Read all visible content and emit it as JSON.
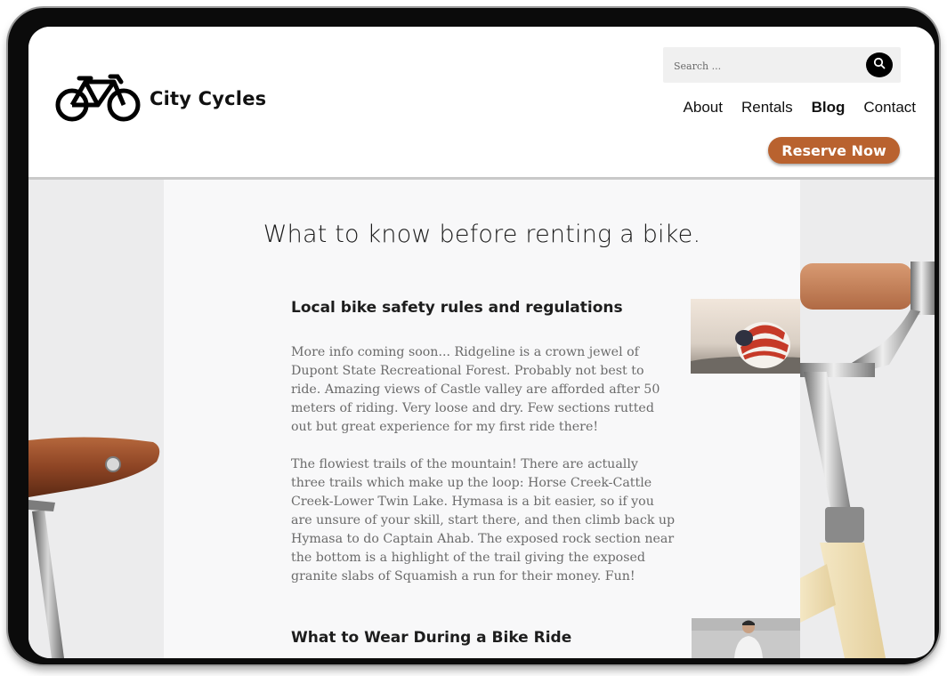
{
  "brand": {
    "name": "City Cycles"
  },
  "search": {
    "placeholder": "Search ..."
  },
  "nav": [
    {
      "label": "About",
      "active": false
    },
    {
      "label": "Rentals",
      "active": false
    },
    {
      "label": "Blog",
      "active": true
    },
    {
      "label": "Contact",
      "active": false
    }
  ],
  "cta": {
    "label": "Reserve Now",
    "color": "#b9622f"
  },
  "page": {
    "title": "What to know before renting a bike."
  },
  "sections": [
    {
      "title": "Local bike safety rules and regulations",
      "paragraphs": [
        "More info coming soon... Ridgeline is a crown jewel of Dupont State Recreational Forest. Probably not best to ride. Amazing views of Castle valley are afforded after 50 meters of riding. Very loose and dry. Few sections rutted out but great experience for my first ride there!",
        "The flowiest trails of the mountain! There are actually three trails which make up the loop: Horse Creek-Cattle Creek-Lower Twin Lake. Hymasa is a bit easier, so if you are unsure of your skill, start there, and then climb back up Hymasa to do Captain Ahab. The exposed rock section near the bottom is a highlight of the trail giving the exposed granite slabs of Squamish a run for their money. Fun!"
      ],
      "image": "helmet-photo"
    },
    {
      "title": "What to Wear During a Bike Ride",
      "image": "cyclist-photo"
    }
  ],
  "icons": {
    "logo": "bicycle-icon",
    "search": "search-icon"
  },
  "colors": {
    "accent": "#b9622f",
    "panel": "#f8f8f9",
    "background": "#ececed"
  }
}
